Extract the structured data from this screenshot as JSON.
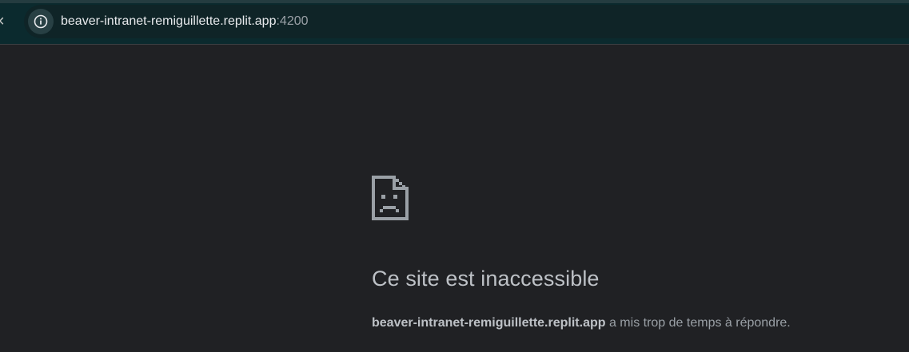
{
  "browser": {
    "close_glyph": "×",
    "site_info_icon": "info-icon",
    "url_host": "beaver-intranet-remiguillette.replit.app",
    "url_port": ":4200"
  },
  "error": {
    "icon": "sad-file-icon",
    "title": "Ce site est inaccessible",
    "detail_host": "beaver-intranet-remiguillette.replit.app",
    "detail_text": " a mis trop de temps à répondre."
  },
  "colors": {
    "page_bg": "#202124",
    "toolbar_bg": "#0b2a2e",
    "text_primary": "#bdc1c6",
    "text_secondary": "#9aa0a6"
  }
}
